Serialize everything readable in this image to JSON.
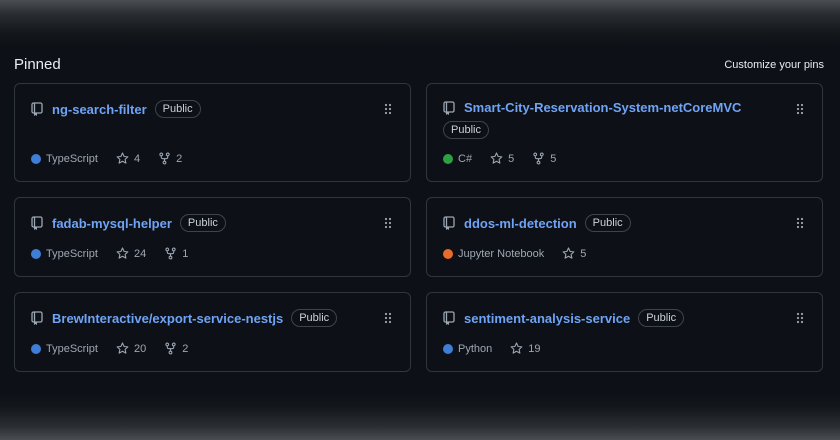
{
  "header": {
    "title": "Pinned",
    "customize_label": "Customize your pins"
  },
  "pins": [
    {
      "name": "ng-search-filter",
      "visibility": "Public",
      "language": "TypeScript",
      "language_color": "#3f7dd6",
      "stars": "4",
      "forks": "2"
    },
    {
      "name": "Smart-City-Reservation-System-netCoreMVC",
      "visibility": "Public",
      "language": "C#",
      "language_color": "#2ea043",
      "stars": "5",
      "forks": "5"
    },
    {
      "name": "fadab-mysql-helper",
      "visibility": "Public",
      "language": "TypeScript",
      "language_color": "#3f7dd6",
      "stars": "24",
      "forks": "1"
    },
    {
      "name": "ddos-ml-detection",
      "visibility": "Public",
      "language": "Jupyter Notebook",
      "language_color": "#e86b2a",
      "stars": "5"
    },
    {
      "name": "BrewInteractive/export-service-nestjs",
      "visibility": "Public",
      "language": "TypeScript",
      "language_color": "#3f7dd6",
      "stars": "20",
      "forks": "2"
    },
    {
      "name": "sentiment-analysis-service",
      "visibility": "Public",
      "language": "Python",
      "language_color": "#3f7dd6",
      "stars": "19"
    }
  ],
  "icons": {
    "repo": "repo-icon",
    "star": "star-icon",
    "fork": "fork-icon",
    "drag": "drag-handle-icon"
  }
}
